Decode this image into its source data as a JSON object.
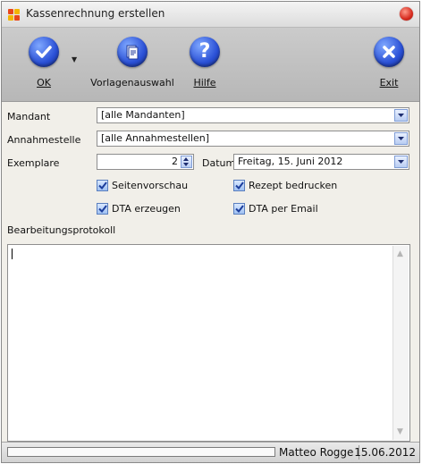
{
  "window": {
    "title": "Kassenrechnung erstellen"
  },
  "toolbar": {
    "ok_label": "OK",
    "templates_label": "Vorlagenauswahl",
    "help_label": "Hilfe",
    "exit_label": "Exit"
  },
  "form": {
    "mandant": {
      "label": "Mandant",
      "value": "[alle Mandanten]"
    },
    "annahmestelle": {
      "label": "Annahmestelle",
      "value": "[alle Annahmestellen]"
    },
    "exemplare": {
      "label": "Exemplare",
      "value": "2"
    },
    "datum": {
      "label": "Datum",
      "value": "Freitag, 15. Juni 2012"
    },
    "checkboxes": [
      {
        "label": "Seitenvorschau",
        "checked": true
      },
      {
        "label": "Rezept bedrucken",
        "checked": true
      },
      {
        "label": "DTA erzeugen",
        "checked": true
      },
      {
        "label": "DTA per Email",
        "checked": true
      }
    ],
    "log_label": "Bearbeitungsprotokoll",
    "log_text": ""
  },
  "status": {
    "progress": 0,
    "user": "Matteo Rogge",
    "date": "15.06.2012"
  },
  "colors": {
    "accent": "#2a50d6",
    "close": "#d62b1f",
    "check": "#1c3e9c"
  }
}
